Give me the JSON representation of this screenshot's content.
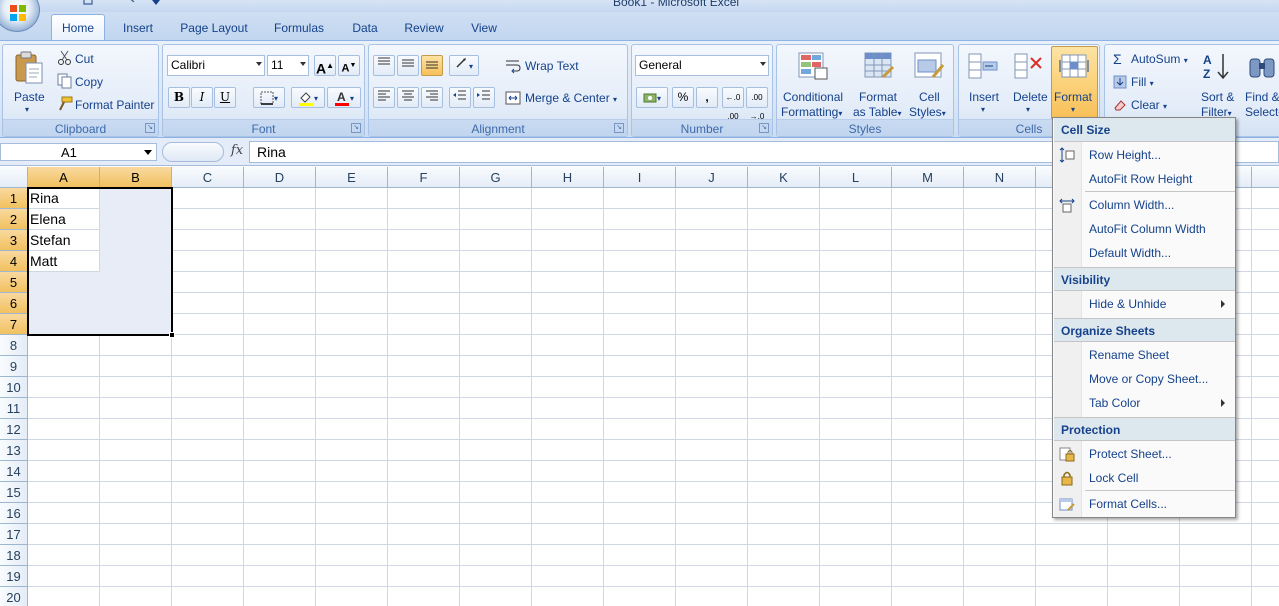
{
  "window": {
    "title": "Book1 - Microsoft Excel"
  },
  "tabs": [
    "Home",
    "Insert",
    "Page Layout",
    "Formulas",
    "Data",
    "Review",
    "View"
  ],
  "clipboard": {
    "paste": "Paste",
    "cut": "Cut",
    "copy": "Copy",
    "format_painter": "Format Painter",
    "label": "Clipboard"
  },
  "font": {
    "name": "Calibri",
    "size": "11",
    "bold": "B",
    "italic": "I",
    "underline": "U",
    "grow": "A",
    "shrink": "A",
    "label": "Font",
    "fill_color": "#ffff00",
    "font_color": "#ff0000"
  },
  "alignment": {
    "wrap": "Wrap Text",
    "merge": "Merge & Center",
    "label": "Alignment"
  },
  "number": {
    "format": "General",
    "percent": "%",
    "comma": ",",
    "label": "Number"
  },
  "styles": {
    "conditional": "Conditional",
    "conditional2": "Formatting",
    "format_as": "Format",
    "format_as2": "as Table",
    "cell": "Cell",
    "cell2": "Styles",
    "label": "Styles"
  },
  "cells": {
    "insert": "Insert",
    "delete": "Delete",
    "format": "Format",
    "label": "Cells"
  },
  "editing": {
    "autosum": "AutoSum",
    "fill": "Fill",
    "clear": "Clear",
    "sort": "Sort &",
    "sort2": "Filter",
    "find": "Find &",
    "find2": "Select"
  },
  "formula_bar": {
    "name_box": "A1",
    "fx": "fx",
    "content": "Rina"
  },
  "grid": {
    "columns": [
      "A",
      "B",
      "C",
      "D",
      "E",
      "F",
      "G",
      "H",
      "I",
      "J",
      "K",
      "L",
      "M",
      "N"
    ],
    "rows": [
      "1",
      "2",
      "3",
      "4",
      "5",
      "6",
      "7",
      "8",
      "9",
      "10",
      "11",
      "12",
      "13",
      "14",
      "15",
      "16",
      "17",
      "18",
      "19",
      "20"
    ],
    "cells": {
      "A1": "Rina",
      "A2": "Elena",
      "A3": "Stefan",
      "A4": "Matt"
    }
  },
  "format_menu": {
    "cell_size": "Cell Size",
    "row_height": "Row Height...",
    "autofit_row": "AutoFit Row Height",
    "column_width": "Column Width...",
    "autofit_column": "AutoFit Column Width",
    "default_width": "Default Width...",
    "visibility": "Visibility",
    "hide_unhide": "Hide & Unhide",
    "organize": "Organize Sheets",
    "rename": "Rename Sheet",
    "move_copy": "Move or Copy Sheet...",
    "tab_color": "Tab Color",
    "protection": "Protection",
    "protect_sheet": "Protect Sheet...",
    "lock_cell": "Lock Cell",
    "format_cells": "Format Cells..."
  }
}
